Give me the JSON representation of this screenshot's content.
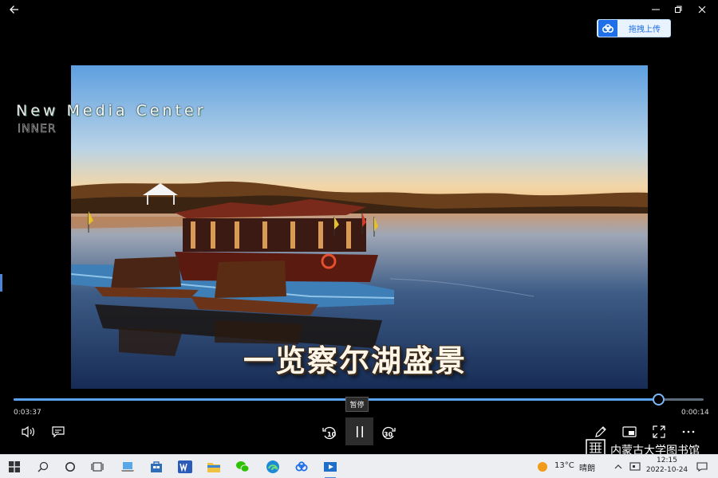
{
  "window": {
    "back_icon": "arrow-left-icon",
    "min_icon": "minimize-icon",
    "max_icon": "maximize-icon",
    "close_icon": "close-icon"
  },
  "upload_button": {
    "label": "拖拽上传",
    "icon": "baidu-netdisk-icon",
    "color": "#1e6fe8"
  },
  "video": {
    "caption": "一览察尔湖盛景",
    "watermark_line1": "New Media Center",
    "watermark_line2": "INNER"
  },
  "player": {
    "current_time": "0:03:37",
    "remaining_time": "0:00:14",
    "progress": 0.934,
    "tooltip": "暂停",
    "skip_back_seconds": "10",
    "skip_forward_seconds": "30",
    "accent": "#5aa3f0",
    "buttons": [
      "volume-icon",
      "subtitles-icon",
      "skip-back-icon",
      "pause-icon",
      "skip-forward-icon",
      "edit-icon",
      "mini-view-icon",
      "fullscreen-icon",
      "more-icon"
    ]
  },
  "library_watermark": {
    "text": "内蒙古大学图书馆"
  },
  "taskbar": {
    "weather_temp": "13°C",
    "weather_desc": "晴朗",
    "time": "12:15",
    "date": "2022-10-24"
  }
}
